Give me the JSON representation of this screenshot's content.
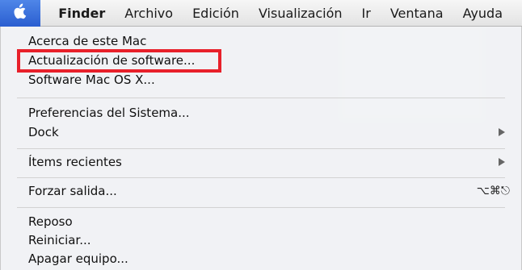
{
  "menubar": {
    "apple_icon": "apple-icon",
    "app_name": "Finder",
    "items": [
      "Archivo",
      "Edición",
      "Visualización",
      "Ir",
      "Ventana",
      "Ayuda"
    ],
    "accent_color": "#3a6fe0"
  },
  "apple_menu": {
    "items": [
      {
        "label": "Acerca de este Mac"
      },
      {
        "label": "Actualización de software..."
      },
      {
        "label": "Software Mac OS X..."
      },
      {
        "label": "Preferencias del Sistema..."
      },
      {
        "label": "Dock",
        "submenu": true
      },
      {
        "label": "Ítems recientes",
        "submenu": true
      },
      {
        "label": "Forzar salida...",
        "shortcut": "⌥⌘⎋"
      },
      {
        "label": "Reposo"
      },
      {
        "label": "Reiniciar..."
      },
      {
        "label": "Apagar equipo..."
      }
    ]
  },
  "annotation": {
    "highlight_color": "#e8202a"
  }
}
